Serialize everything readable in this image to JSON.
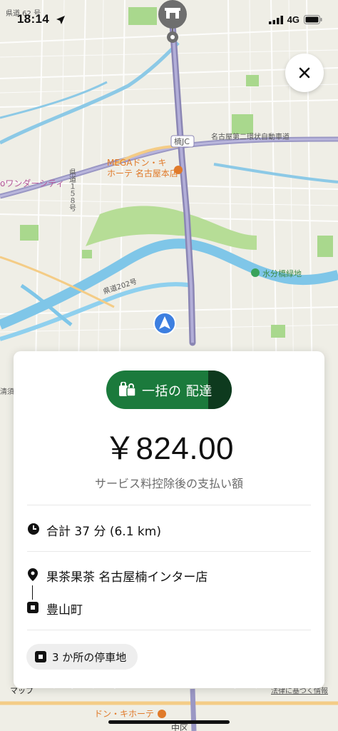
{
  "status_bar": {
    "time": "18:14",
    "network": "4G"
  },
  "map": {
    "labels": {
      "route62": "県道 62 号",
      "wonder_city": "oワンダーシティ",
      "prefectural_158": "県道１５８号",
      "mega_line1": "MEGAドン・キ",
      "mega_line2": "ホーテ 名古屋本店",
      "kusu_jc": "楠JC",
      "ring_road": "名古屋第二環状自動車道",
      "suibun": "水分橋緑地",
      "route202": "県道202号",
      "kiyosu": "清須",
      "donki_bottom": "ドン・キホーテ",
      "maps_brand": "マップ",
      "legal": "法律に基づく情報",
      "bottom_town": "中区"
    }
  },
  "card": {
    "badge_label": "一括の 配達",
    "amount": "￥824.00",
    "amount_caption": "サービス料控除後の支払い額",
    "duration": "合計 37 分 (6.1 km)",
    "pickup": "果茶果茶 名古屋楠インター店",
    "dropoff": "豊山町",
    "stops": "3 か所の停車地"
  },
  "colors": {
    "brand_green": "#1b7a3c",
    "brand_green_dark": "#0e3a1e",
    "route_purple": "#8b86b4",
    "river": "#7fc6e8",
    "park": "#a9d88d"
  },
  "icons": [
    "location-arrow-icon",
    "signal-icon",
    "battery-icon",
    "close-icon",
    "store-pin-icon",
    "navigation-arrow-icon",
    "bags-icon",
    "clock-icon",
    "pickup-pin-icon",
    "dropoff-square-icon",
    "stop-square-icon"
  ]
}
